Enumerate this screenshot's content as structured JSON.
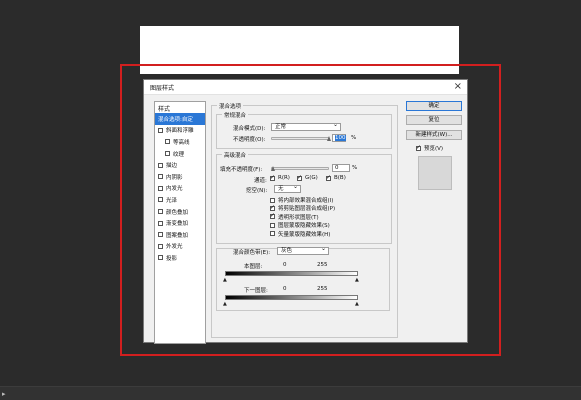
{
  "dialog": {
    "title": "图层样式",
    "close_glyph": "×"
  },
  "styles_panel": {
    "header": "样式",
    "items": [
      {
        "label": "混合选项:自定",
        "checkbox": false,
        "checked": false,
        "active": true,
        "sub": false
      },
      {
        "label": "斜面和浮雕",
        "checkbox": true,
        "checked": false,
        "active": false,
        "sub": false
      },
      {
        "label": "等高线",
        "checkbox": true,
        "checked": false,
        "active": false,
        "sub": true
      },
      {
        "label": "纹理",
        "checkbox": true,
        "checked": false,
        "active": false,
        "sub": true
      },
      {
        "label": "描边",
        "checkbox": true,
        "checked": false,
        "active": false,
        "sub": false
      },
      {
        "label": "内阴影",
        "checkbox": true,
        "checked": false,
        "active": false,
        "sub": false
      },
      {
        "label": "内发光",
        "checkbox": true,
        "checked": false,
        "active": false,
        "sub": false
      },
      {
        "label": "光泽",
        "checkbox": true,
        "checked": false,
        "active": false,
        "sub": false
      },
      {
        "label": "颜色叠加",
        "checkbox": true,
        "checked": false,
        "active": false,
        "sub": false
      },
      {
        "label": "渐变叠加",
        "checkbox": true,
        "checked": false,
        "active": false,
        "sub": false
      },
      {
        "label": "图案叠加",
        "checkbox": true,
        "checked": false,
        "active": false,
        "sub": false
      },
      {
        "label": "外发光",
        "checkbox": true,
        "checked": false,
        "active": false,
        "sub": false
      },
      {
        "label": "投影",
        "checkbox": true,
        "checked": false,
        "active": false,
        "sub": false
      }
    ]
  },
  "blend_options": {
    "section": "混合选项",
    "general": {
      "title": "常规混合",
      "mode_label": "混合模式(D):",
      "mode_value": "正常",
      "opacity_label": "不透明度(O):",
      "opacity_value": "100",
      "opacity_unit": "%",
      "opacity_fraction": 1.0
    },
    "advanced": {
      "title": "高级混合",
      "fill_label": "填充不透明度(F):",
      "fill_value": "0",
      "fill_unit": "%",
      "fill_fraction": 0.0,
      "channels_label": "通道:",
      "channels": [
        {
          "label": "R(R)",
          "checked": true
        },
        {
          "label": "G(G)",
          "checked": true
        },
        {
          "label": "B(B)",
          "checked": true
        }
      ],
      "knockout_label": "挖空(N):",
      "knockout_value": "无",
      "options": [
        {
          "label": "将内部效果混合成组(I)",
          "checked": false
        },
        {
          "label": "将剪贴图层混合成组(P)",
          "checked": true
        },
        {
          "label": "透明形状图层(T)",
          "checked": true
        },
        {
          "label": "图层蒙版隐藏效果(S)",
          "checked": false
        },
        {
          "label": "矢量蒙版隐藏效果(H)",
          "checked": false
        }
      ]
    },
    "blend_if": {
      "label": "混合颜色带(E):",
      "value": "灰色",
      "this_layer_label": "本图层:",
      "this_layer_min": "0",
      "this_layer_max": "255",
      "underlying_label": "下一图层:",
      "underlying_min": "0",
      "underlying_max": "255"
    }
  },
  "buttons": {
    "ok": "确定",
    "reset": "复位",
    "new_style": "新建样式(W)...",
    "preview": "预览(V)",
    "preview_checked": true
  },
  "bottom_bar": {
    "arrow_glyph": "▸"
  }
}
